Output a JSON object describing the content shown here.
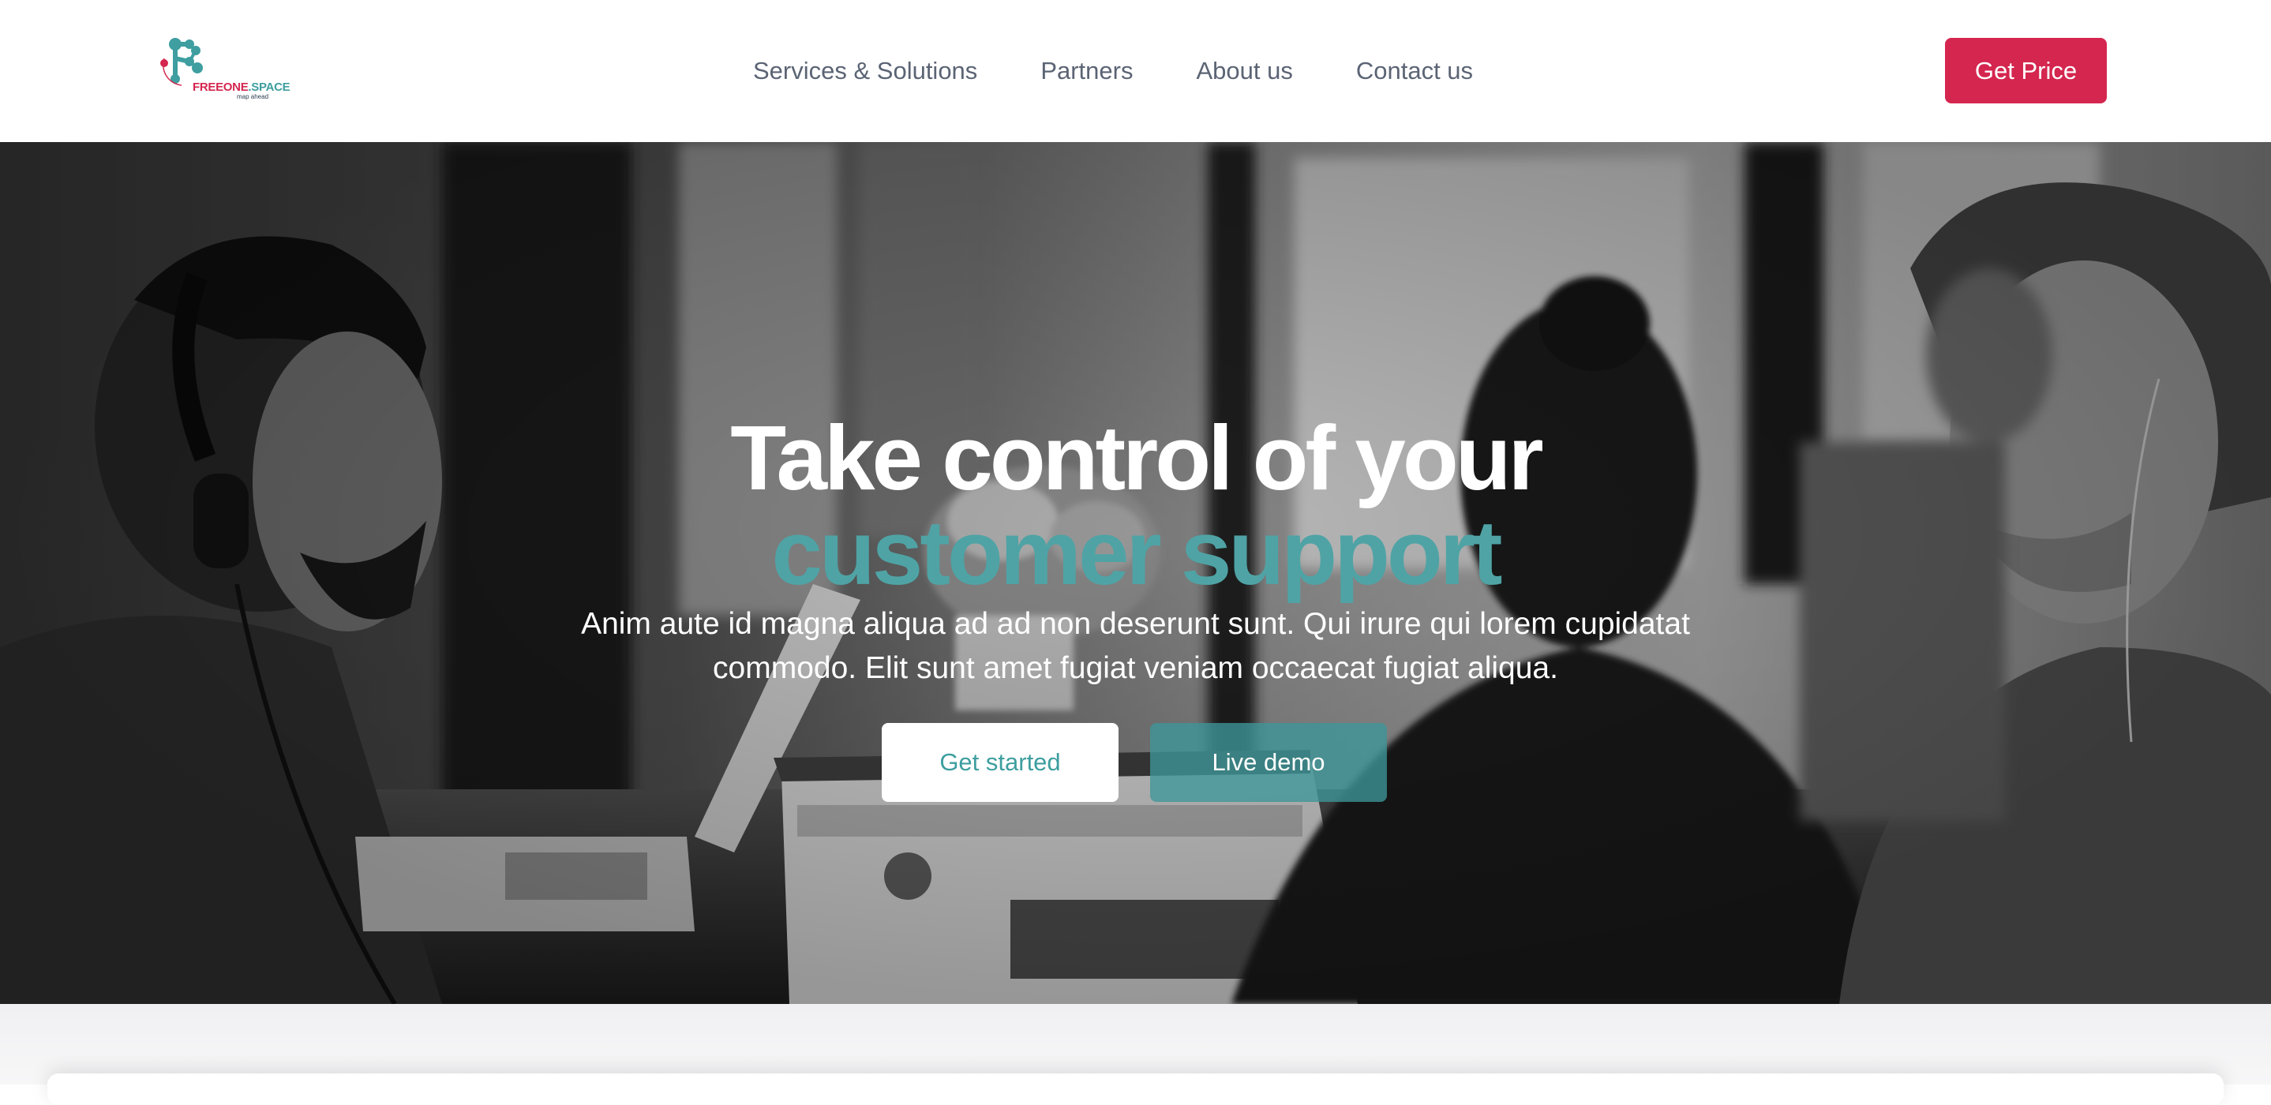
{
  "header": {
    "logo": {
      "name_part1": "FREEONE",
      "name_part2": ".SPACE",
      "tagline": "map ahead"
    },
    "nav": [
      {
        "label": "Services & Solutions"
      },
      {
        "label": "Partners"
      },
      {
        "label": "About us"
      },
      {
        "label": "Contact us"
      }
    ],
    "cta_label": "Get Price"
  },
  "hero": {
    "title_line1": "Take control of your",
    "title_line2": "customer support",
    "subtitle": "Anim aute id magna aliqua ad ad non deserunt sunt. Qui irure qui lorem cupidatat commodo. Elit sunt amet fugiat veniam occaecat fugiat aliqua.",
    "primary_button": "Get started",
    "secondary_button": "Live demo",
    "background_image": "grayscale photo of people working on laptops"
  },
  "colors": {
    "brand_red": "#d4264f",
    "brand_teal": "#4fa3a5",
    "nav_text": "#5b6474"
  }
}
